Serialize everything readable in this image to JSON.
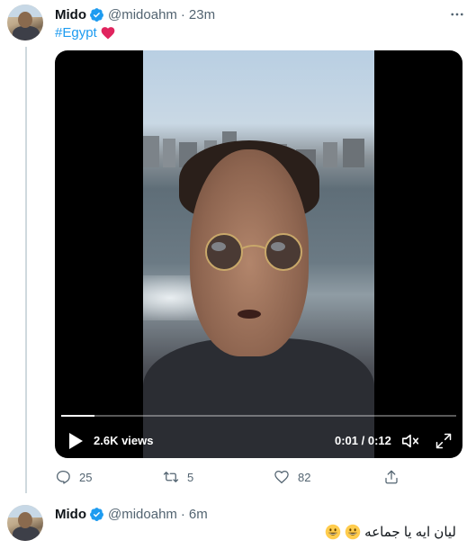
{
  "tweet": {
    "author_name": "Mido",
    "author_handle": "@midoahm",
    "separator": "·",
    "timestamp": "23m",
    "text": "#Egypt",
    "emoji": "red-heart",
    "video": {
      "views": "2.6K views",
      "duration": "0:01 / 0:12",
      "progress": 0.085
    },
    "actions": {
      "replies": "25",
      "retweets": "5",
      "likes": "82"
    }
  },
  "reply": {
    "author_name": "Mido",
    "author_handle": "@midoahm",
    "separator": "·",
    "timestamp": "6m",
    "text": "ليان ايه يا جماعه",
    "emoji": "grinning-face x2"
  },
  "colors": {
    "link": "#1d9bf0",
    "verified": "#1d9bf0",
    "muted": "#536471",
    "heart": "#e0245e"
  }
}
